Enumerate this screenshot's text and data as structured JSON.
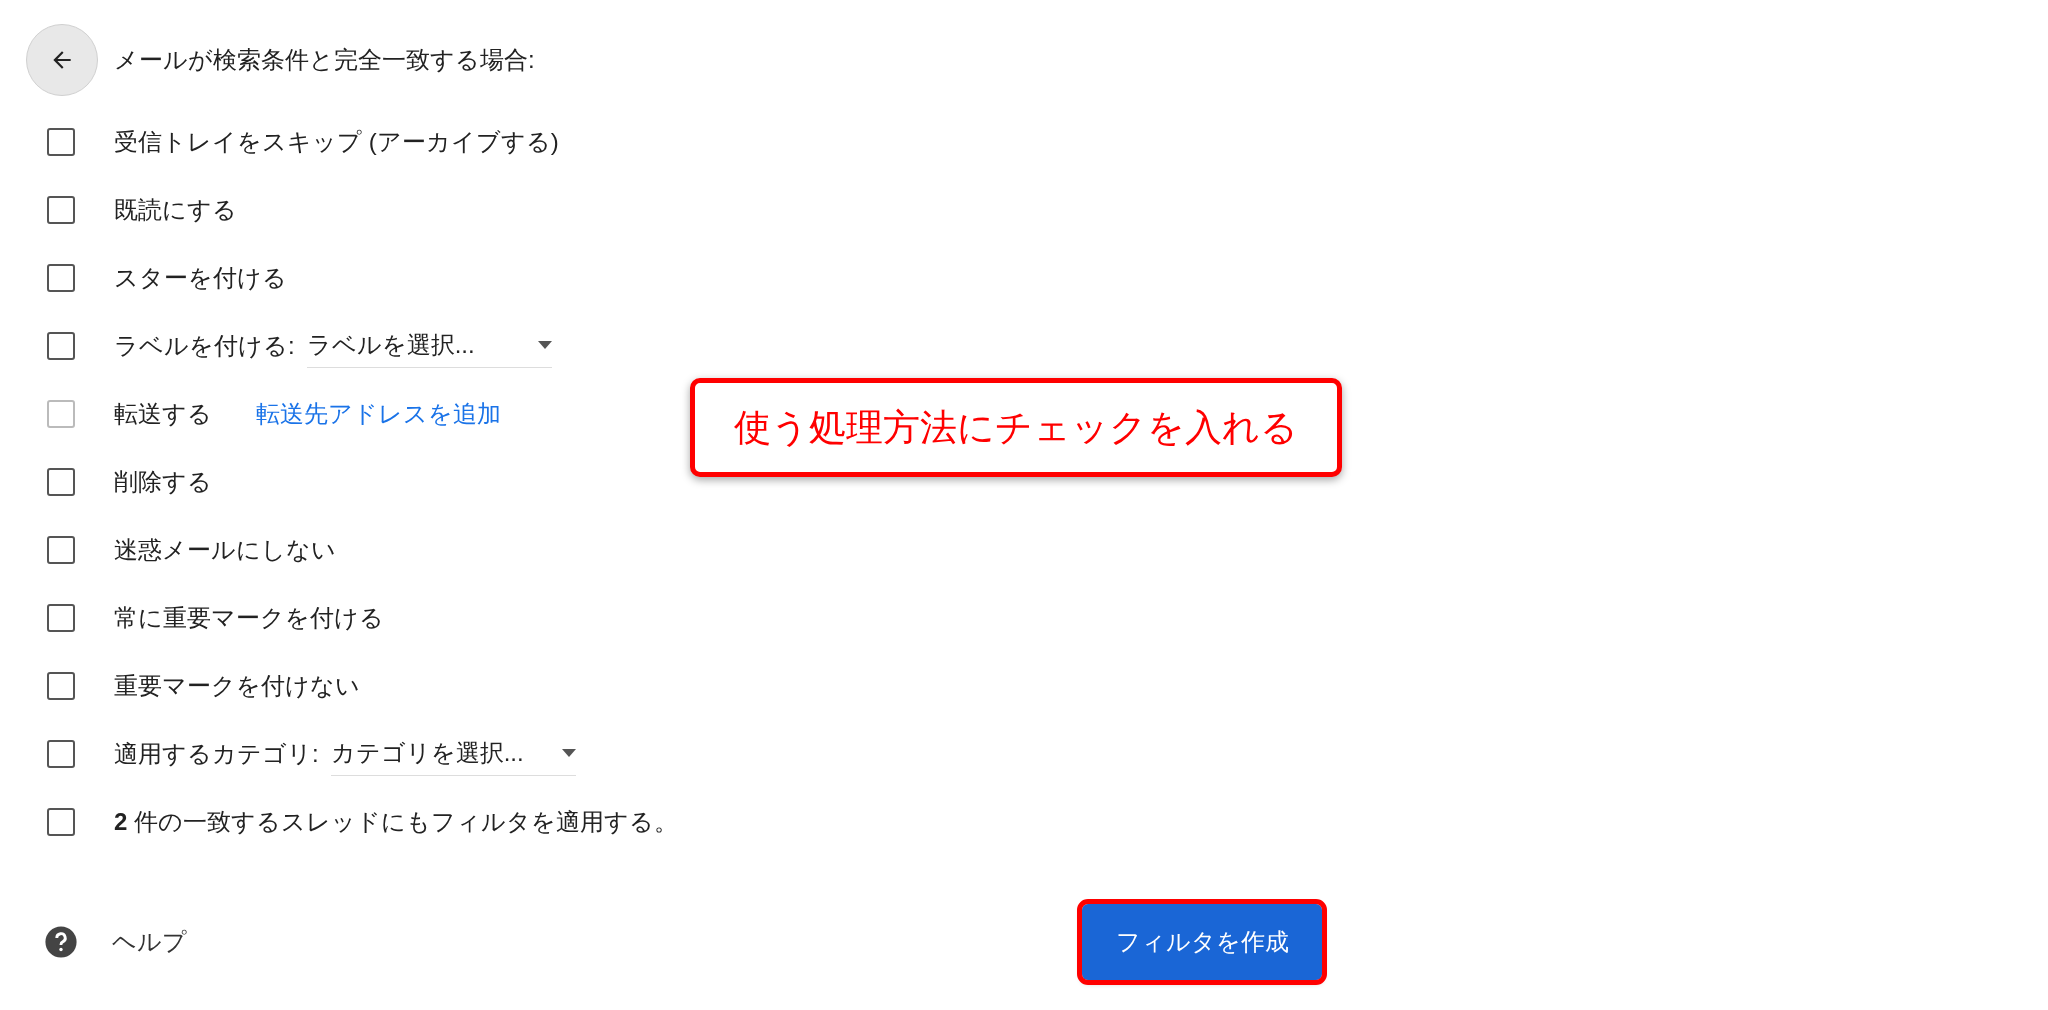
{
  "header": {
    "title": "メールが検索条件と完全一致する場合:"
  },
  "actions": [
    {
      "kind": "plain",
      "label": "受信トレイをスキップ (アーカイブする)",
      "checked": false,
      "disabled": false
    },
    {
      "kind": "plain",
      "label": "既読にする",
      "checked": false,
      "disabled": false
    },
    {
      "kind": "plain",
      "label": "スターを付ける",
      "checked": false,
      "disabled": false
    },
    {
      "kind": "select",
      "label": "ラベルを付ける:",
      "select_value": "ラベルを選択...",
      "checked": false,
      "disabled": false
    },
    {
      "kind": "link",
      "label": "転送する",
      "link": "転送先アドレスを追加",
      "checked": false,
      "disabled": true
    },
    {
      "kind": "plain",
      "label": "削除する",
      "checked": false,
      "disabled": false
    },
    {
      "kind": "plain",
      "label": "迷惑メールにしない",
      "checked": false,
      "disabled": false
    },
    {
      "kind": "plain",
      "label": "常に重要マークを付ける",
      "checked": false,
      "disabled": false
    },
    {
      "kind": "plain",
      "label": "重要マークを付けない",
      "checked": false,
      "disabled": false
    },
    {
      "kind": "select",
      "label": "適用するカテゴリ:",
      "select_value": "カテゴリを選択...",
      "checked": false,
      "disabled": false
    },
    {
      "kind": "plain",
      "label": "**2** 件の一致するスレッドにもフィルタを適用する。",
      "checked": false,
      "disabled": false
    }
  ],
  "help": "ヘルプ",
  "create_button": "フィルタを作成",
  "callout": "使う処理方法にチェックを入れる"
}
